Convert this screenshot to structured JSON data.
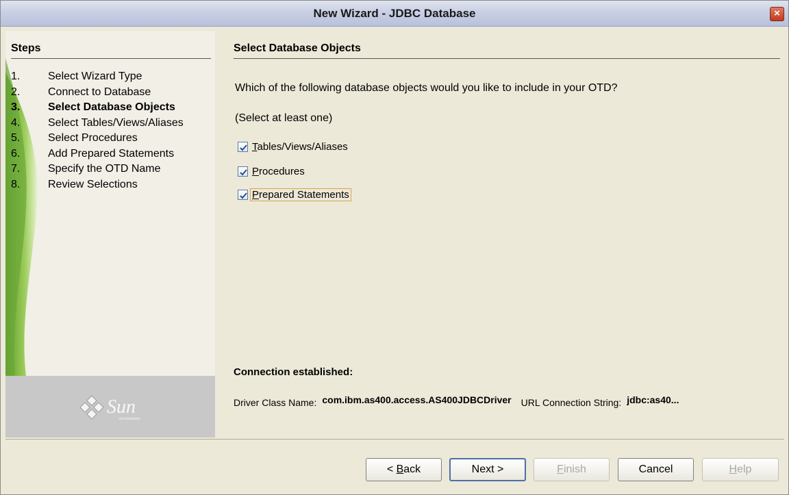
{
  "window": {
    "title": "New Wizard - JDBC Database",
    "close_glyph": "×"
  },
  "steps": {
    "heading": "Steps",
    "items": [
      {
        "num": "1.",
        "label": "Select Wizard Type",
        "current": false
      },
      {
        "num": "2.",
        "label": "Connect to Database",
        "current": false
      },
      {
        "num": "3.",
        "label": "Select Database Objects",
        "current": true
      },
      {
        "num": "4.",
        "label": "Select Tables/Views/Aliases",
        "current": false
      },
      {
        "num": "5.",
        "label": "Select Procedures",
        "current": false
      },
      {
        "num": "6.",
        "label": "Add Prepared Statements",
        "current": false
      },
      {
        "num": "7.",
        "label": "Specify the OTD Name",
        "current": false
      },
      {
        "num": "8.",
        "label": "Review Selections",
        "current": false
      }
    ],
    "logo_text": "Sun",
    "logo_subtext": "microsystems"
  },
  "main": {
    "heading": "Select Database Objects",
    "question": "Which of the following database objects would you like to include in your OTD?",
    "hint": "(Select at least one)",
    "options": [
      {
        "mnemonic": "T",
        "rest": "ables/Views/Aliases",
        "checked": true,
        "focused": false
      },
      {
        "mnemonic": "P",
        "rest": "rocedures",
        "checked": true,
        "focused": false
      },
      {
        "mnemonic": "P",
        "rest": "repared Statements",
        "checked": true,
        "focused": true
      }
    ]
  },
  "connection": {
    "heading": "Connection established:",
    "driver_label": "Driver Class Name:",
    "driver_value": "com.ibm.as400.access.AS400JDBCDriver",
    "url_label": "URL Connection String:",
    "url_value": "jdbc:as40..."
  },
  "buttons": {
    "back_prefix": "< ",
    "back_mnemonic": "B",
    "back_rest": "ack",
    "next": "Next >",
    "finish_mnemonic": "F",
    "finish_rest": "inish",
    "cancel": "Cancel",
    "help_mnemonic": "H",
    "help_rest": "elp",
    "finish_enabled": false,
    "help_enabled": false
  },
  "colors": {
    "accent": "#4d6fa6",
    "focus": "#d9a44a",
    "swoosh": "#7ab03a",
    "title_bar": "#c9d0e4"
  }
}
